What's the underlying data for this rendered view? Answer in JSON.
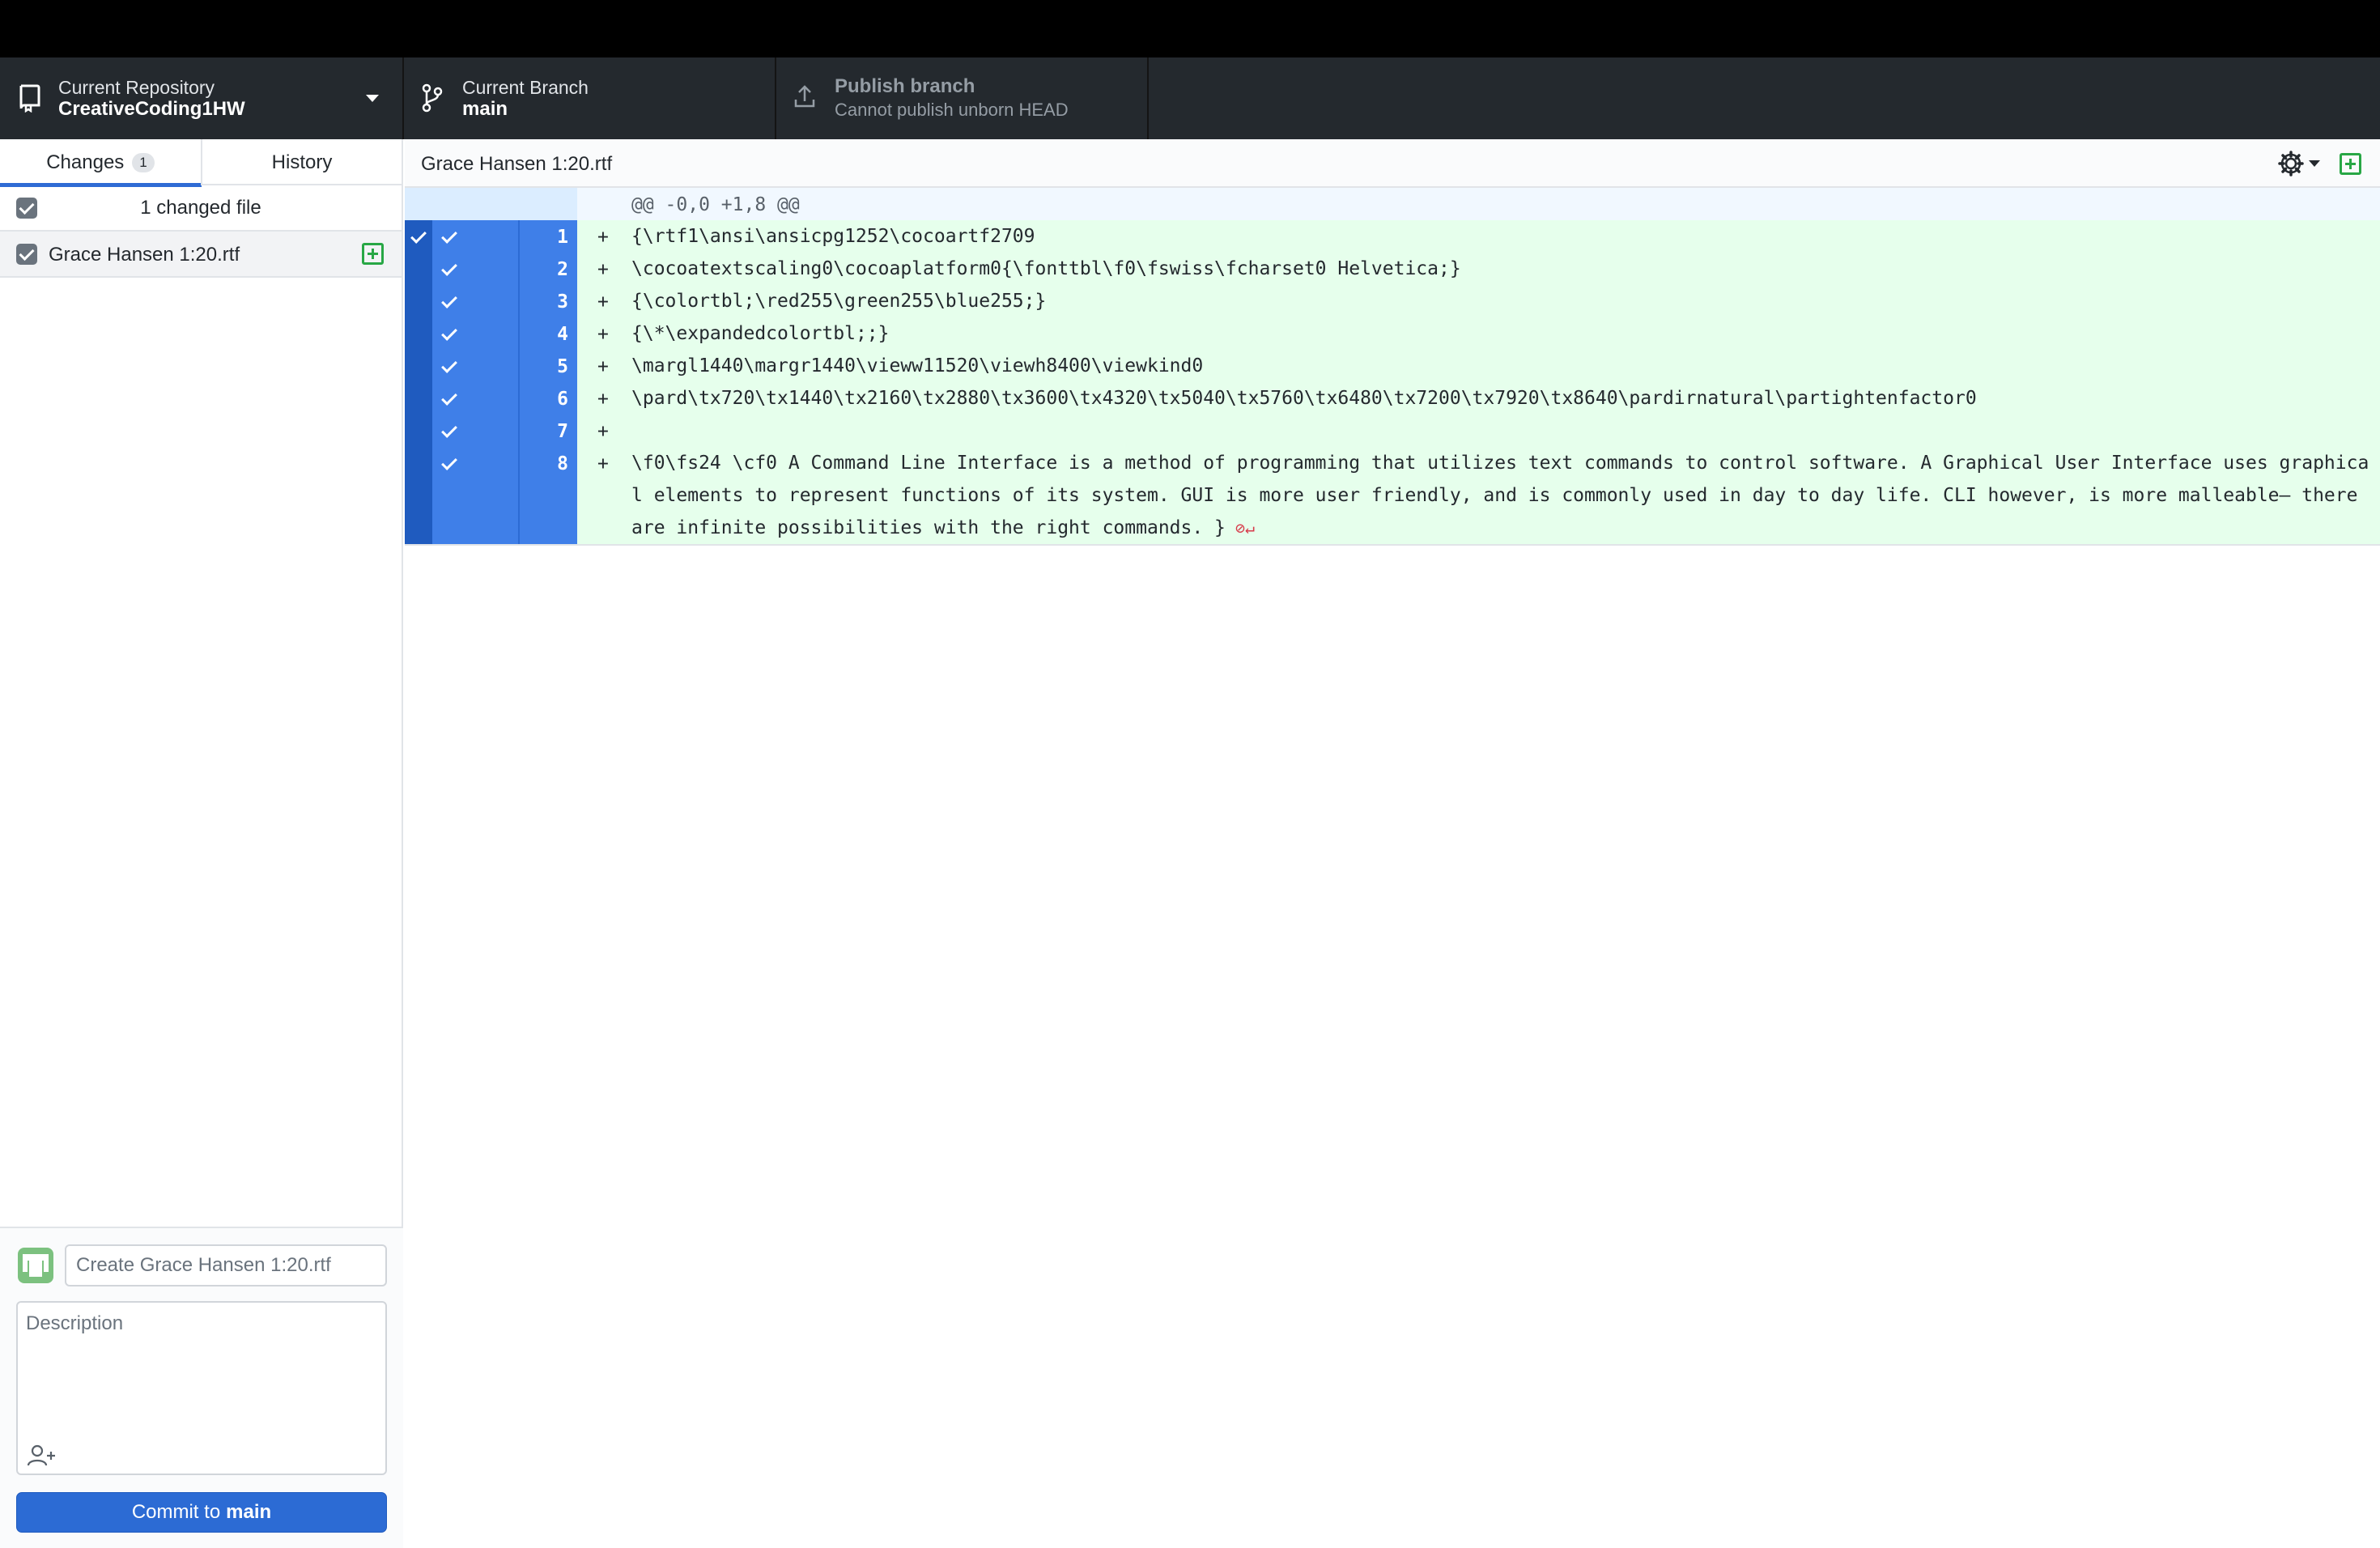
{
  "toolbar": {
    "repo_label": "Current Repository",
    "repo_value": "CreativeCoding1HW",
    "branch_label": "Current Branch",
    "branch_value": "main",
    "publish_label": "Publish branch",
    "publish_value": "Cannot publish unborn HEAD"
  },
  "sidebar": {
    "tab_changes": "Changes",
    "tab_changes_count": "1",
    "tab_history": "History",
    "changed_summary": "1 changed file",
    "files": [
      {
        "name": "Grace Hansen 1:20.rtf"
      }
    ]
  },
  "commit": {
    "summary_placeholder": "Create Grace Hansen 1:20.rtf",
    "description_placeholder": "Description",
    "button_label": "Commit to",
    "button_branch": "main"
  },
  "diff": {
    "filename": "Grace Hansen 1:20.rtf",
    "hunk_header": "@@ -0,0 +1,8 @@",
    "lines": [
      {
        "num": "1",
        "marker": "+",
        "text": "{\\rtf1\\ansi\\ansicpg1252\\cocoartf2709"
      },
      {
        "num": "2",
        "marker": "+",
        "text": "\\cocoatextscaling0\\cocoaplatform0{\\fonttbl\\f0\\fswiss\\fcharset0 Helvetica;}"
      },
      {
        "num": "3",
        "marker": "+",
        "text": "{\\colortbl;\\red255\\green255\\blue255;}"
      },
      {
        "num": "4",
        "marker": "+",
        "text": "{\\*\\expandedcolortbl;;}"
      },
      {
        "num": "5",
        "marker": "+",
        "text": "\\margl1440\\margr1440\\vieww11520\\viewh8400\\viewkind0"
      },
      {
        "num": "6",
        "marker": "+",
        "text": "\\pard\\tx720\\tx1440\\tx2160\\tx2880\\tx3600\\tx4320\\tx5040\\tx5760\\tx6480\\tx7200\\tx7920\\tx8640\\pardirnatural\\partightenfactor0"
      },
      {
        "num": "7",
        "marker": "+",
        "text": ""
      },
      {
        "num": "8",
        "marker": "+",
        "text": "\\f0\\fs24 \\cf0 A Command Line Interface is a method of programming that utilizes text commands to control software. A Graphical User Interface uses graphical elements to represent functions of its system. GUI is more user friendly, and is commonly used in day to day life. CLI however, is more malleable— there are infinite possibilities with the right commands. }",
        "no_newline_icon": "no-newline-icon"
      }
    ]
  },
  "colors": {
    "toolbar_bg": "#24292e",
    "accent_blue": "#2c6bd4",
    "added_line_bg": "#e6ffec",
    "added_green": "#28a745"
  }
}
